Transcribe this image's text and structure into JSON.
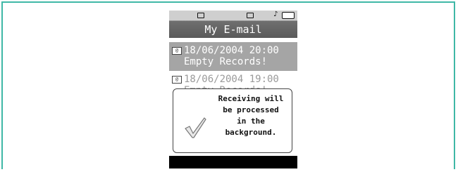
{
  "screen": {
    "title": "My E-mail",
    "status_icons": [
      "envelope-icon",
      "message-icon",
      "music-note-icon",
      "battery-icon"
    ]
  },
  "emails": [
    {
      "date": "18/06/2004 20:00",
      "subject": "Empty Records!",
      "selected": true
    },
    {
      "date": "18/06/2004 19:00",
      "subject": "Empty Records!",
      "selected": false
    }
  ],
  "dialog": {
    "message": "Receiving will be processed in the background.",
    "message_lines": "Receiving will\nbe processed\nin the\nbackground.",
    "icon": "checkmark-icon"
  },
  "colors": {
    "frame_border": "#3fb8a6",
    "title_bar": "#5f5f5f",
    "selected_row": "#a5a5a5",
    "softkey_bar": "#000000"
  }
}
